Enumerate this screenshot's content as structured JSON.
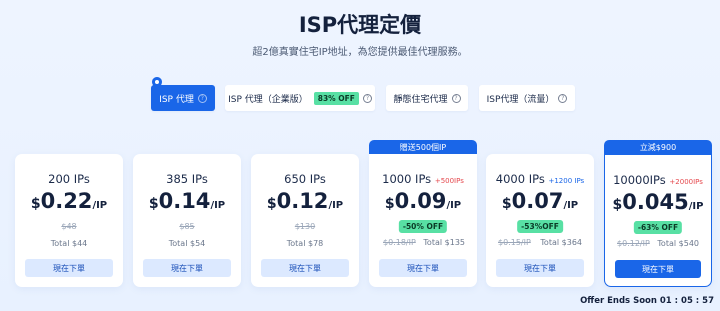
{
  "header": {
    "title": "ISP代理定價",
    "subtitle": "超2億真實住宅IP地址，為您提供最佳代理服務。"
  },
  "tabs": [
    {
      "label": "ISP 代理",
      "active": true
    },
    {
      "label": "ISP 代理（企業版）",
      "badge": "83% OFF"
    },
    {
      "label": "靜態住宅代理"
    },
    {
      "label": "ISP代理（流量）"
    }
  ],
  "plans": [
    {
      "ips": "200 IPs",
      "currency": "$",
      "price": "0.22",
      "unit": "/IP",
      "original": "$48",
      "total": "Total $44",
      "button": "現在下單"
    },
    {
      "ips": "385 IPs",
      "currency": "$",
      "price": "0.14",
      "unit": "/IP",
      "original": "$85",
      "total": "Total $54",
      "button": "現在下單"
    },
    {
      "ips": "650 IPs",
      "currency": "$",
      "price": "0.12",
      "unit": "/IP",
      "original": "$130",
      "total": "Total $78",
      "button": "現在下單"
    },
    {
      "ips": "1000 IPs",
      "bonus": "+500IPs",
      "ribbon": "贈送500個IP",
      "currency": "$",
      "price": "0.09",
      "unit": "/IP",
      "discount": "-50% OFF",
      "original": "$0.18/IP",
      "total": "Total $135",
      "button": "現在下單"
    },
    {
      "ips": "4000 IPs",
      "bonus": "+1200 IPs",
      "currency": "$",
      "price": "0.07",
      "unit": "/IP",
      "discount": "-53%OFF",
      "original": "$0.15/IP",
      "total": "Total $364",
      "button": "現在下單"
    },
    {
      "ips": "10000IPs",
      "bonus": "+2000IPs",
      "ribbon": "立減$900",
      "currency": "$",
      "price": "0.045",
      "unit": "/IP",
      "discount": "-63% OFF",
      "original": "$0.12/IP",
      "total": "Total $540",
      "button": "現在下單"
    }
  ],
  "footer": {
    "countdown": "Offer Ends Soon 01 : 05 : 57"
  },
  "colors": {
    "accent": "#1a66e8",
    "discount_badge": "#58e0a4",
    "bonus_text_blue": "#1a66e8",
    "bonus_text_red": "#e5484d"
  }
}
